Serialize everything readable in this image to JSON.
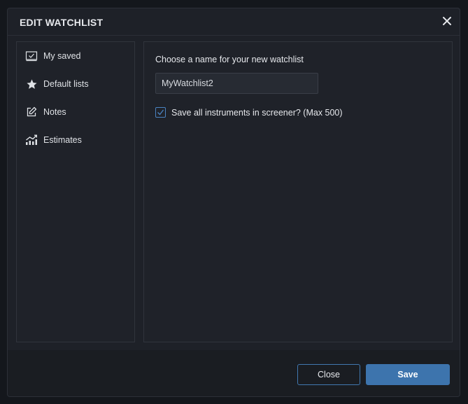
{
  "dialog": {
    "title": "EDIT WATCHLIST",
    "close_icon": "close-icon"
  },
  "sidebar": {
    "items": [
      {
        "label": "My saved",
        "icon": "checkbox-icon"
      },
      {
        "label": "Default lists",
        "icon": "star-icon"
      },
      {
        "label": "Notes",
        "icon": "edit-icon"
      },
      {
        "label": "Estimates",
        "icon": "chart-trend-icon"
      }
    ]
  },
  "form": {
    "name_label": "Choose a name for your new watchlist",
    "name_value": "MyWatchlist2",
    "save_all_label": "Save all instruments in screener? (Max 500)",
    "save_all_checked": true
  },
  "footer": {
    "close_label": "Close",
    "save_label": "Save"
  },
  "colors": {
    "accent": "#3d74ad",
    "background": "#1e2128",
    "text": "#e6e8ec"
  }
}
